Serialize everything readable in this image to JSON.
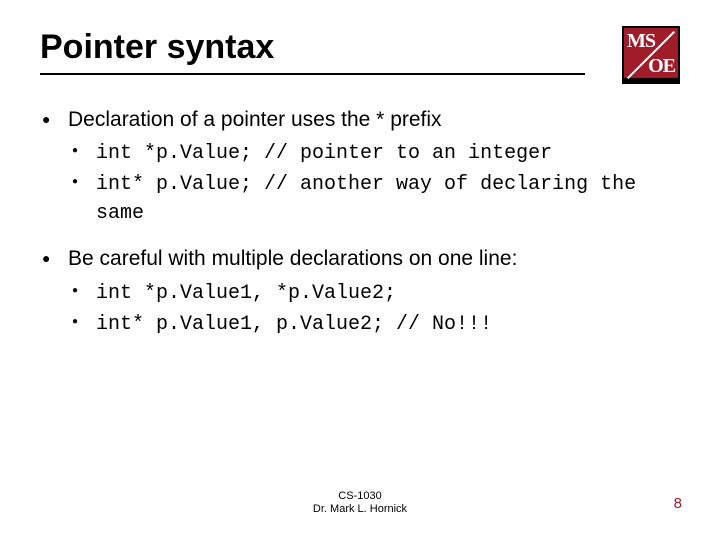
{
  "logo": {
    "top": "MS",
    "bottom": "OE"
  },
  "title": "Pointer syntax",
  "bullets": [
    {
      "text": "Declaration of a pointer uses the * prefix",
      "sub": [
        {
          "code": "int *p.Value; // pointer to an integer"
        },
        {
          "code": "int* p.Value; // another way of declaring the same"
        }
      ]
    },
    {
      "text": "Be careful with multiple declarations on one line:",
      "sub": [
        {
          "code": "int *p.Value1, *p.Value2;"
        },
        {
          "code": "int* p.Value1, p.Value2; // No!!!"
        }
      ]
    }
  ],
  "footer": {
    "line1": "CS-1030",
    "line2": "Dr. Mark L. Hornick"
  },
  "page": "8"
}
